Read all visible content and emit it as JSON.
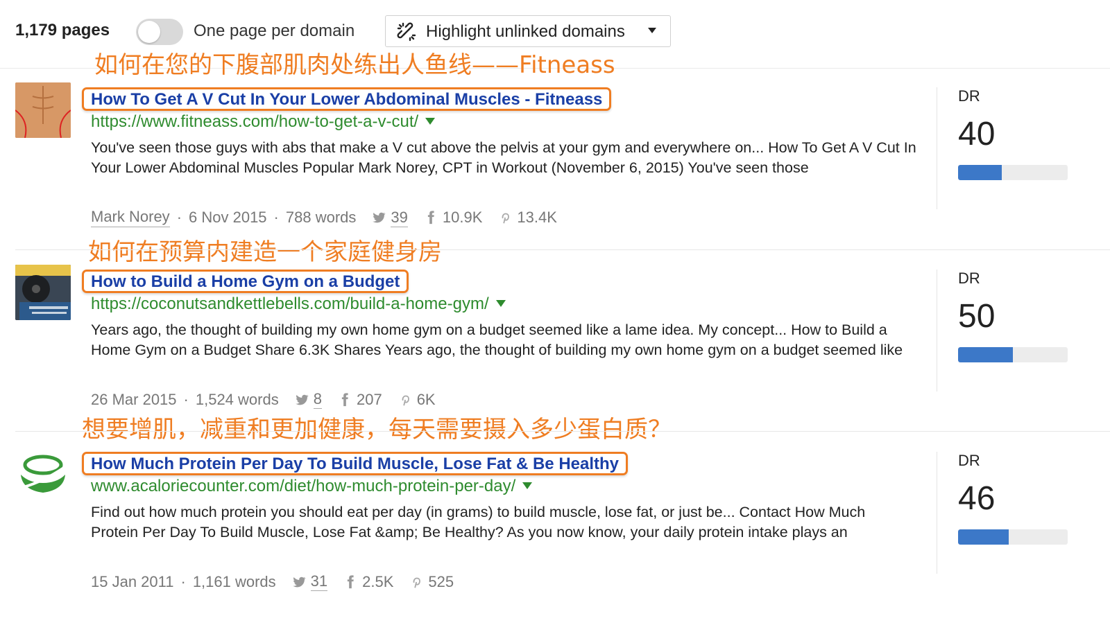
{
  "header": {
    "page_count": "1,179 pages",
    "toggle_label": "One page per domain",
    "toggle_on": false,
    "highlight_label": "Highlight unlinked domains"
  },
  "annotations": [
    "如何在您的下腹部肌肉处练出人鱼线——Fitneass",
    "如何在预算内建造一个家庭健身房",
    "想要增肌，减重和更加健康，每天需要摄入多少蛋白质？"
  ],
  "results": [
    {
      "title": "How To Get A V Cut In Your Lower Abdominal Muscles - Fitneass",
      "url": "https://www.fitneass.com/how-to-get-a-v-cut/",
      "snippet": "You've seen those guys with abs that make a V cut above the pelvis at your gym and everywhere on... How To Get A V Cut In Your Lower Abdominal Muscles Popular Mark Norey, CPT in Workout (November 6, 2015) You've seen those",
      "author": "Mark Norey",
      "date": "6 Nov 2015",
      "words": "788 words",
      "twitter": "39",
      "facebook": "10.9K",
      "pinterest": "13.4K",
      "dr_label": "DR",
      "dr": "40",
      "dr_fraction": 0.4
    },
    {
      "title": "How to Build a Home Gym on a Budget",
      "url": "https://coconutsandkettlebells.com/build-a-home-gym/",
      "snippet": "Years ago, the thought of building my own home gym on a budget seemed like a lame idea. My concept... How to Build a Home Gym on a Budget Share 6.3K Shares Years ago, the thought of building my own home gym on a budget seemed like",
      "author": "",
      "date": "26 Mar 2015",
      "words": "1,524 words",
      "twitter": "8",
      "facebook": "207",
      "pinterest": "6K",
      "dr_label": "DR",
      "dr": "50",
      "dr_fraction": 0.5
    },
    {
      "title": "How Much Protein Per Day To Build Muscle, Lose Fat & Be Healthy",
      "url": "www.acaloriecounter.com/diet/how-much-protein-per-day/",
      "snippet": "Find out how much protein you should eat per day (in grams) to build muscle, lose fat, or just be... Contact How Much Protein Per Day To Build Muscle, Lose Fat &amp; Be Healthy? As you now know, your daily protein intake plays an",
      "author": "",
      "date": "15 Jan 2011",
      "words": "1,161 words",
      "twitter": "31",
      "facebook": "2.5K",
      "pinterest": "525",
      "dr_label": "DR",
      "dr": "46",
      "dr_fraction": 0.46
    }
  ],
  "colors": {
    "annotation": "#ef7d22",
    "title_link": "#1a3fa6",
    "url": "#2e8b2e",
    "dr_bar": "#3c78c8"
  }
}
